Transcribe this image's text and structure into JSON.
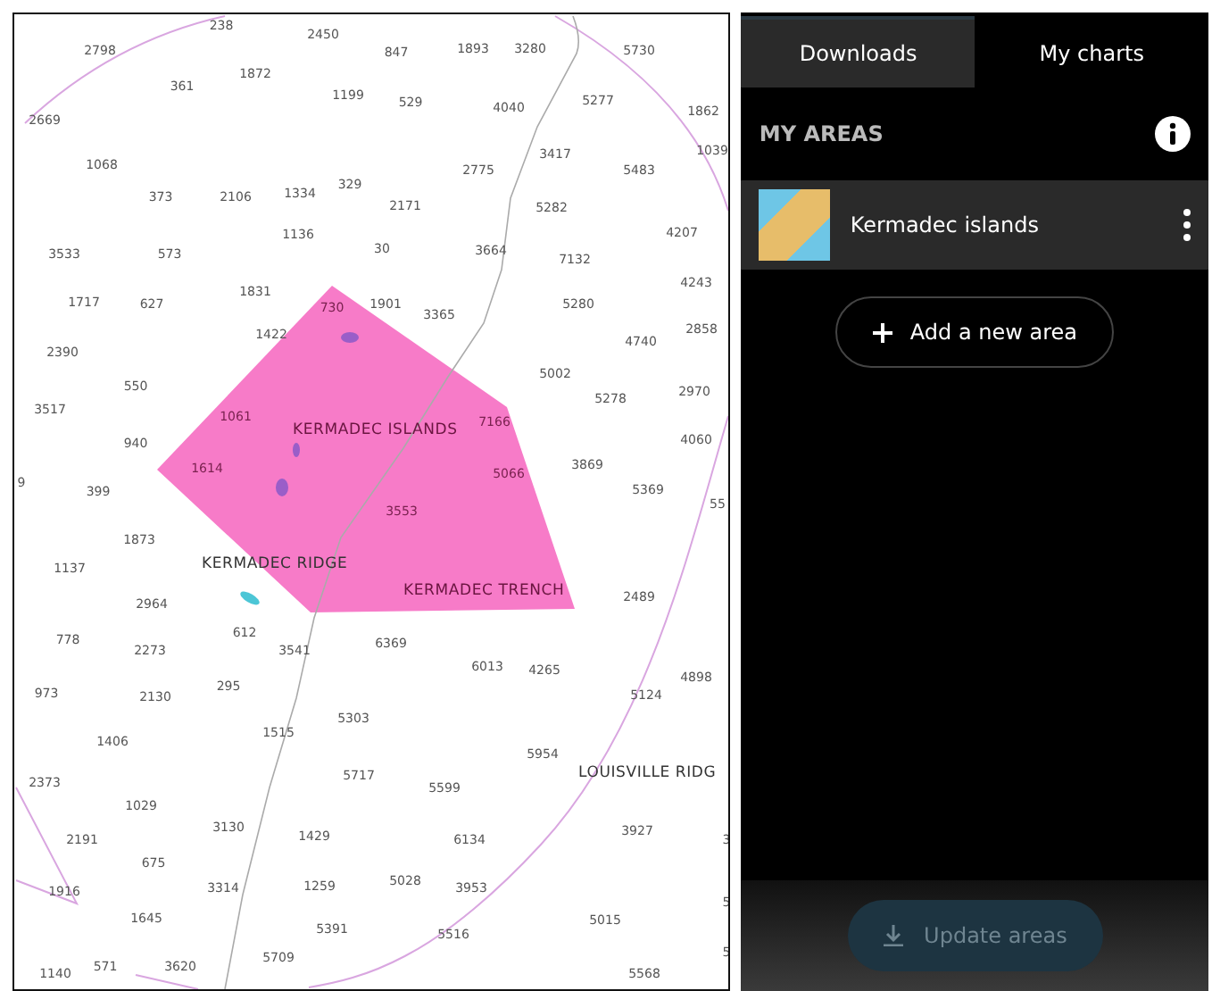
{
  "map": {
    "soundings": [
      "238",
      "2450",
      "2798",
      "847",
      "1893",
      "3280",
      "5730",
      "1872",
      "361",
      "1199",
      "529",
      "4040",
      "5277",
      "1862",
      "2669",
      "1039",
      "1068",
      "3417",
      "2775",
      "5483",
      "329",
      "373",
      "2106",
      "1334",
      "2171",
      "5282",
      "4207",
      "1136",
      "3533",
      "573",
      "30",
      "3664",
      "7132",
      "4243",
      "1717",
      "627",
      "1831",
      "730",
      "1901",
      "3365",
      "5280",
      "2858",
      "1422",
      "4740",
      "2390",
      "5002",
      "550",
      "5278",
      "2970",
      "3517",
      "1061",
      "7166",
      "940",
      "4060",
      "3869",
      "1614",
      "5066",
      "9",
      "399",
      "5369",
      "55",
      "3553",
      "1873",
      "1137",
      "2964",
      "2489",
      "612",
      "778",
      "3541",
      "6369",
      "2273",
      "6013",
      "4265",
      "4898",
      "973",
      "2130",
      "295",
      "5124",
      "5303",
      "1515",
      "1406",
      "5954",
      "5717",
      "5599",
      "2373",
      "1029",
      "2191",
      "3130",
      "1429",
      "6134",
      "3927",
      "3",
      "675",
      "1916",
      "3314",
      "1259",
      "5028",
      "3953",
      "5",
      "1645",
      "5391",
      "5516",
      "5015",
      "1140",
      "571",
      "3620",
      "5709",
      "5568",
      "5"
    ],
    "place_labels": [
      {
        "text": "KERMADEC ISLANDS",
        "kind": "area"
      },
      {
        "text": "KERMADEC RIDGE",
        "kind": "feature"
      },
      {
        "text": "KERMADEC TRENCH",
        "kind": "area"
      },
      {
        "text": "LOUISVILLE RIDG",
        "kind": "feature"
      }
    ]
  },
  "tabs": [
    {
      "label": "Downloads",
      "selected": true
    },
    {
      "label": "My charts",
      "selected": false
    }
  ],
  "my_areas": {
    "title": "MY AREAS",
    "areas": [
      {
        "name": "Kermadec islands"
      }
    ]
  },
  "add_area_button": "Add a new area",
  "update_button": {
    "label": "Update areas",
    "disabled": true
  }
}
